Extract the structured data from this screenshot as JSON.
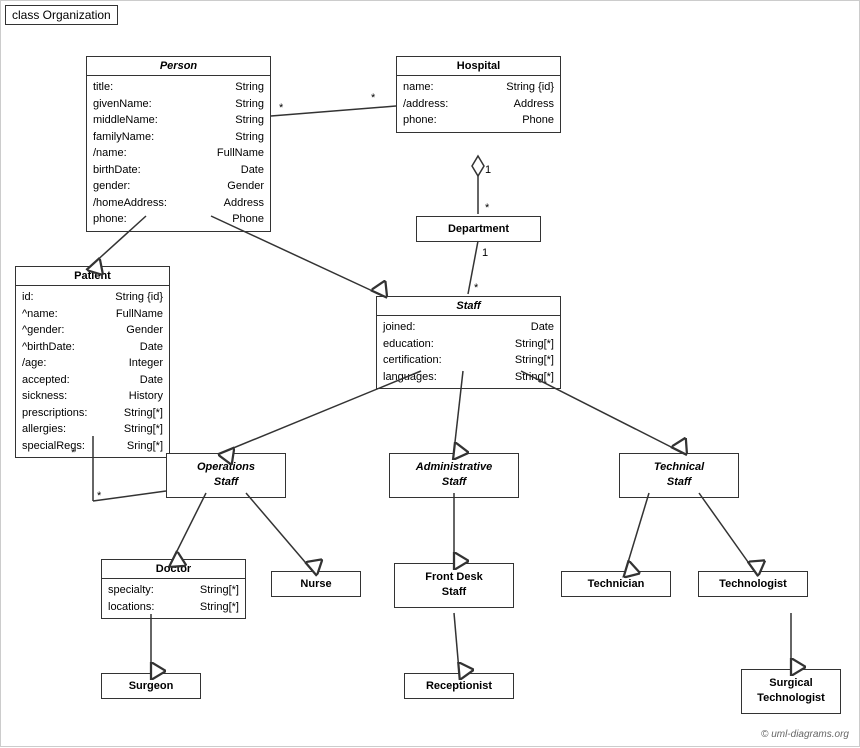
{
  "diagram": {
    "title": "class Organization",
    "classes": {
      "person": {
        "name": "Person",
        "italic": true,
        "attrs": [
          [
            "title:",
            "String"
          ],
          [
            "givenName:",
            "String"
          ],
          [
            "middleName:",
            "String"
          ],
          [
            "familyName:",
            "String"
          ],
          [
            "/name:",
            "FullName"
          ],
          [
            "birthDate:",
            "Date"
          ],
          [
            "gender:",
            "Gender"
          ],
          [
            "/homeAddress:",
            "Address"
          ],
          [
            "phone:",
            "Phone"
          ]
        ]
      },
      "hospital": {
        "name": "Hospital",
        "italic": false,
        "attrs": [
          [
            "name:",
            "String {id}"
          ],
          [
            "/address:",
            "Address"
          ],
          [
            "phone:",
            "Phone"
          ]
        ]
      },
      "department": {
        "name": "Department",
        "italic": false
      },
      "staff": {
        "name": "Staff",
        "italic": true,
        "attrs": [
          [
            "joined:",
            "Date"
          ],
          [
            "education:",
            "String[*]"
          ],
          [
            "certification:",
            "String[*]"
          ],
          [
            "languages:",
            "String[*]"
          ]
        ]
      },
      "patient": {
        "name": "Patient",
        "italic": false,
        "attrs": [
          [
            "id:",
            "String {id}"
          ],
          [
            "^name:",
            "FullName"
          ],
          [
            "^gender:",
            "Gender"
          ],
          [
            "^birthDate:",
            "Date"
          ],
          [
            "/age:",
            "Integer"
          ],
          [
            "accepted:",
            "Date"
          ],
          [
            "sickness:",
            "History"
          ],
          [
            "prescriptions:",
            "String[*]"
          ],
          [
            "allergies:",
            "String[*]"
          ],
          [
            "specialReqs:",
            "Sring[*]"
          ]
        ]
      },
      "operations_staff": {
        "name": "Operations\nStaff",
        "italic": true
      },
      "admin_staff": {
        "name": "Administrative\nStaff",
        "italic": true
      },
      "technical_staff": {
        "name": "Technical\nStaff",
        "italic": true
      },
      "doctor": {
        "name": "Doctor",
        "italic": false,
        "attrs": [
          [
            "specialty:",
            "String[*]"
          ],
          [
            "locations:",
            "String[*]"
          ]
        ]
      },
      "nurse": {
        "name": "Nurse",
        "italic": false
      },
      "front_desk": {
        "name": "Front Desk\nStaff",
        "italic": false
      },
      "technician": {
        "name": "Technician",
        "italic": false
      },
      "technologist": {
        "name": "Technologist",
        "italic": false
      },
      "surgeon": {
        "name": "Surgeon",
        "italic": false
      },
      "receptionist": {
        "name": "Receptionist",
        "italic": false
      },
      "surgical_technologist": {
        "name": "Surgical\nTechnologist",
        "italic": false
      }
    },
    "multiplicities": {
      "hospital_person_star": "*",
      "hospital_dept_1": "1",
      "hospital_dept_star": "*",
      "dept_staff_1": "1",
      "dept_staff_star": "*",
      "patient_star": "*",
      "ops_star": "*"
    },
    "copyright": "© uml-diagrams.org"
  }
}
